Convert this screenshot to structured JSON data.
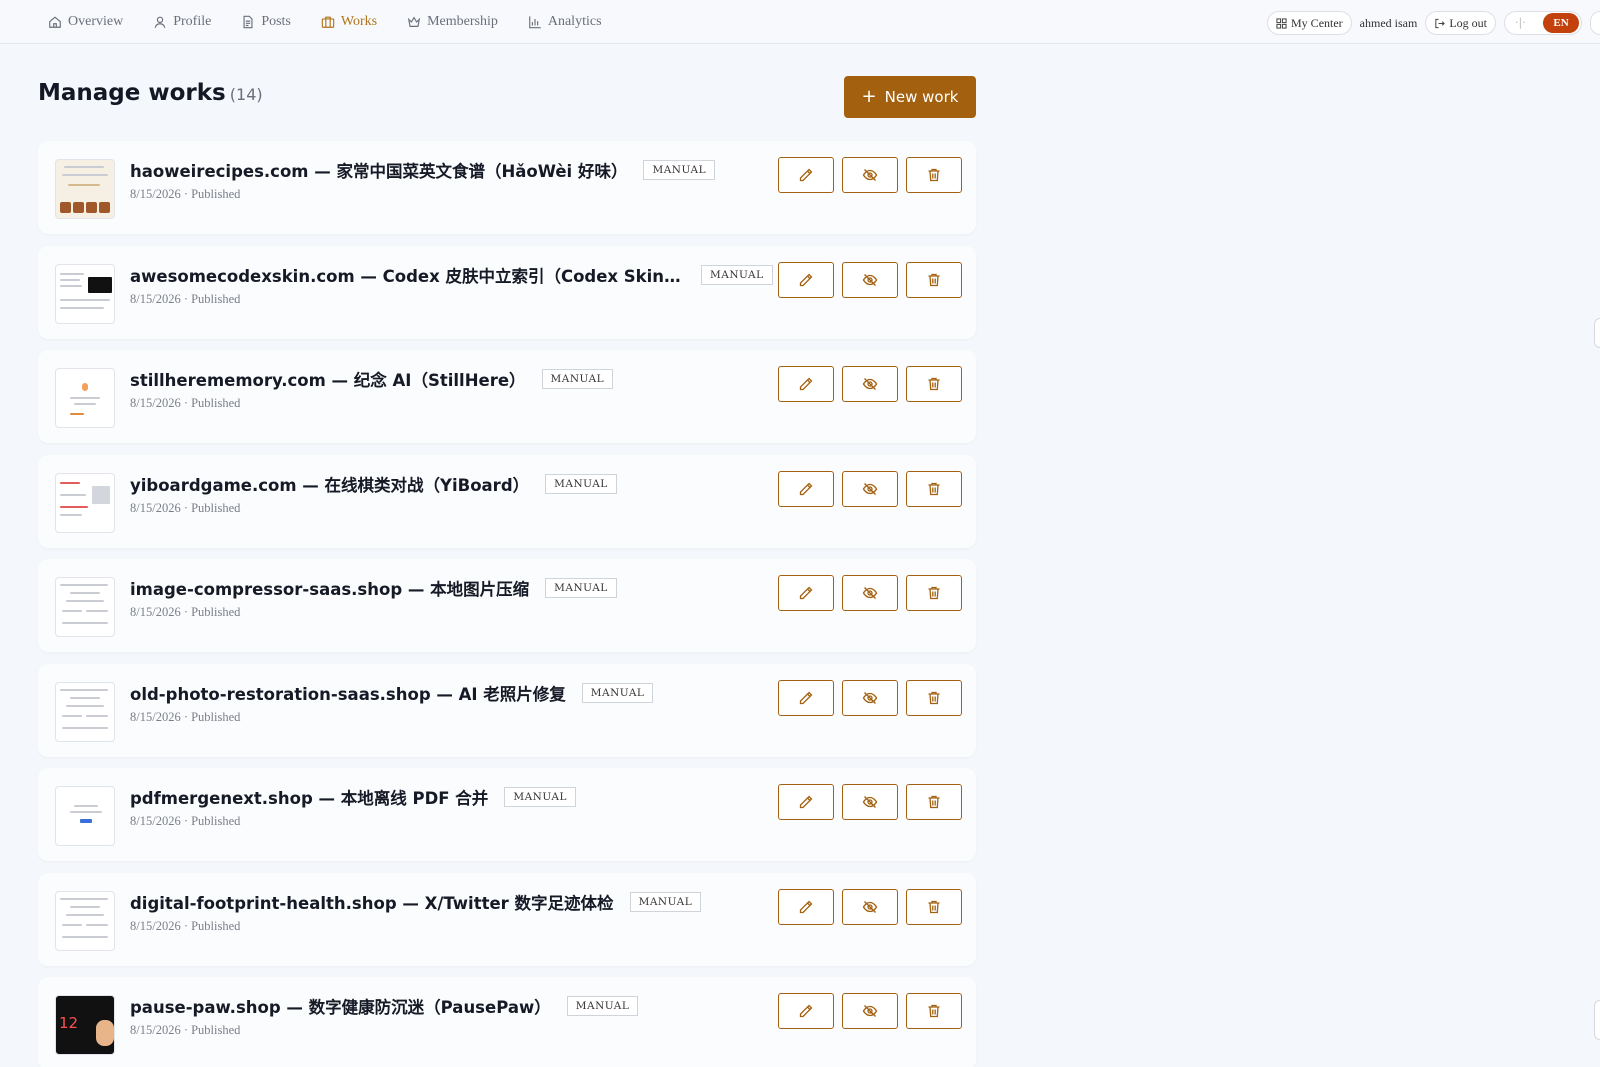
{
  "nav": {
    "items": [
      {
        "label": "Overview",
        "icon": "home-icon",
        "active": false
      },
      {
        "label": "Profile",
        "icon": "user-icon",
        "active": false
      },
      {
        "label": "Posts",
        "icon": "document-icon",
        "active": false
      },
      {
        "label": "Works",
        "icon": "briefcase-icon",
        "active": true
      },
      {
        "label": "Membership",
        "icon": "crown-icon",
        "active": false
      },
      {
        "label": "Analytics",
        "icon": "chart-icon",
        "active": false
      }
    ],
    "my_center": "My Center",
    "user": "ahmed isam",
    "logout": "Log out",
    "lang_active": "EN"
  },
  "page": {
    "title": "Manage works",
    "count": "(14)",
    "new_button": "New work"
  },
  "colors": {
    "accent": "#a3600f",
    "active_nav": "#b0741a",
    "lang_bg": "#c2410c"
  },
  "works": [
    {
      "title": "haoweirecipes.com — 家常中国菜英文食谱（HǎoWèi 好味）",
      "badge": "MANUAL",
      "meta": "8/15/2026 · Published",
      "thumb": "recipes"
    },
    {
      "title": "awesomecodexskin.com — Codex 皮肤中立索引（Codex Skin Index）",
      "badge": "MANUAL",
      "meta": "8/15/2026 · Published",
      "thumb": "dark-panel"
    },
    {
      "title": "stillherememory.com — 纪念 AI（StillHere）",
      "badge": "MANUAL",
      "meta": "8/15/2026 · Published",
      "thumb": "memorial"
    },
    {
      "title": "yiboardgame.com — 在线棋类对战（YiBoard）",
      "badge": "MANUAL",
      "meta": "8/15/2026 · Published",
      "thumb": "board"
    },
    {
      "title": "image-compressor-saas.shop — 本地图片压缩",
      "badge": "MANUAL",
      "meta": "8/15/2026 · Published",
      "thumb": "doc"
    },
    {
      "title": "old-photo-restoration-saas.shop — AI 老照片修复",
      "badge": "MANUAL",
      "meta": "8/15/2026 · Published",
      "thumb": "doc"
    },
    {
      "title": "pdfmergenext.shop — 本地离线 PDF 合并",
      "badge": "MANUAL",
      "meta": "8/15/2026 · Published",
      "thumb": "pdf"
    },
    {
      "title": "digital-footprint-health.shop — X/Twitter 数字足迹体检",
      "badge": "MANUAL",
      "meta": "8/15/2026 · Published",
      "thumb": "doc"
    },
    {
      "title": "pause-paw.shop — 数字健康防沉迷（PausePaw）",
      "badge": "MANUAL",
      "meta": "8/15/2026 · Published",
      "thumb": "dark-12",
      "thumb_text": "12"
    }
  ]
}
